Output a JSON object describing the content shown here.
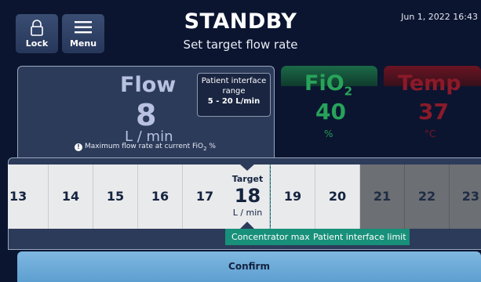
{
  "header": {
    "lock_label": "Lock",
    "menu_label": "Menu",
    "status": "STANDBY",
    "instruction": "Set target flow rate",
    "datetime": "Jun 1, 2022 16:43"
  },
  "flow": {
    "title": "Flow",
    "value": "8",
    "unit": "L / min",
    "note": "Maximum flow rate at current FiO",
    "note_sub": "2",
    "note_suffix": " %",
    "range_box": {
      "line1": "Patient interface",
      "line2": "range",
      "line3": "5 - 20 L/min"
    }
  },
  "fio2": {
    "title": "FiO",
    "sub": "2",
    "value": "40",
    "unit": "%"
  },
  "temp": {
    "title": "Temp",
    "value": "37",
    "unit": "°C"
  },
  "selector": {
    "values": [
      "13",
      "14",
      "15",
      "16",
      "17",
      "18",
      "19",
      "20",
      "21",
      "22",
      "23"
    ],
    "target_label": "Target",
    "target_value": "18",
    "target_unit": "L / min",
    "concentrator_max_label": "Concentrator max",
    "patient_interface_limit_label": "Patient interface limit"
  },
  "confirm_label": "Confirm",
  "colors": {
    "background": "#0b1530",
    "panel": "#2c3b5a",
    "fio2_green": "#27a25a",
    "temp_red": "#8a1a2a",
    "teal": "#18907a",
    "confirm_blue": "#6aa9d6"
  },
  "icons": {
    "lock": "lock-icon",
    "menu": "hamburger-menu-icon",
    "warning": "warning-icon",
    "marker": "triangle-marker-icon"
  }
}
